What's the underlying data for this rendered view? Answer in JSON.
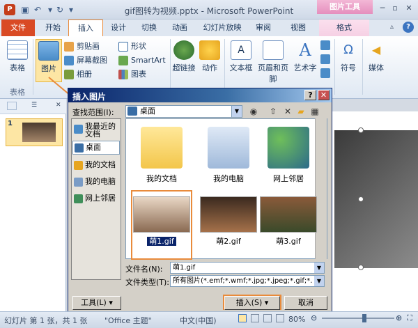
{
  "window": {
    "title": "gif图转为视频.pptx - Microsoft PowerPoint",
    "contextual_header": "图片工具",
    "app_icon": "P"
  },
  "tabs": {
    "file": "文件",
    "home": "开始",
    "insert": "插入",
    "design": "设计",
    "transitions": "切换",
    "animations": "动画",
    "slideshow": "幻灯片放映",
    "review": "审阅",
    "view": "视图",
    "format": "格式"
  },
  "ribbon": {
    "table": "表格",
    "picture": "图片",
    "clipart": "剪贴画",
    "screenshot": "屏幕截图",
    "album": "相册",
    "shapes": "形状",
    "smartart": "SmartArt",
    "chart": "图表",
    "hyperlink": "超链接",
    "action": "动作",
    "textbox": "文本框",
    "header_footer": "页眉和页脚",
    "wordart": "艺术字",
    "symbol": "符号",
    "media": "媒体",
    "group_table": "表格"
  },
  "slides_panel": {
    "thumb_number": "1"
  },
  "dialog": {
    "title": "插入图片",
    "help_btn": "?",
    "close_btn": "✕",
    "lookin_label": "查找范围(I):",
    "lookin_value": "桌面",
    "places": {
      "recent": "我最近的文档",
      "desktop": "桌面",
      "documents": "我的文档",
      "computer": "我的电脑",
      "network": "网上邻居"
    },
    "files": [
      {
        "label": "我的文档",
        "icon": "folder-documents-icon"
      },
      {
        "label": "我的电脑",
        "icon": "computer-icon"
      },
      {
        "label": "网上邻居",
        "icon": "network-icon"
      },
      {
        "label": "萌1.gif",
        "icon": "image-thumbnail"
      },
      {
        "label": "萌2.gif",
        "icon": "image-thumbnail"
      },
      {
        "label": "萌3.gif",
        "icon": "image-thumbnail"
      }
    ],
    "filename_label": "文件名(N):",
    "filename_value": "萌1.gif",
    "filetype_label": "文件类型(T):",
    "filetype_value": "所有图片(*.emf;*.wmf;*.jpg;*.jpeg;*.gif;*.",
    "tools_btn": "工具(L)",
    "insert_btn": "插入(S)",
    "cancel_btn": "取消"
  },
  "statusbar": {
    "slide_info": "幻灯片 第 1 张，共 1 张",
    "theme": "\"Office 主题\"",
    "language": "中文(中国)",
    "zoom": "80%"
  },
  "colors": {
    "accent_orange": "#e98b3b",
    "file_tab": "#d94a24",
    "dialog_title": "#0a246a"
  }
}
